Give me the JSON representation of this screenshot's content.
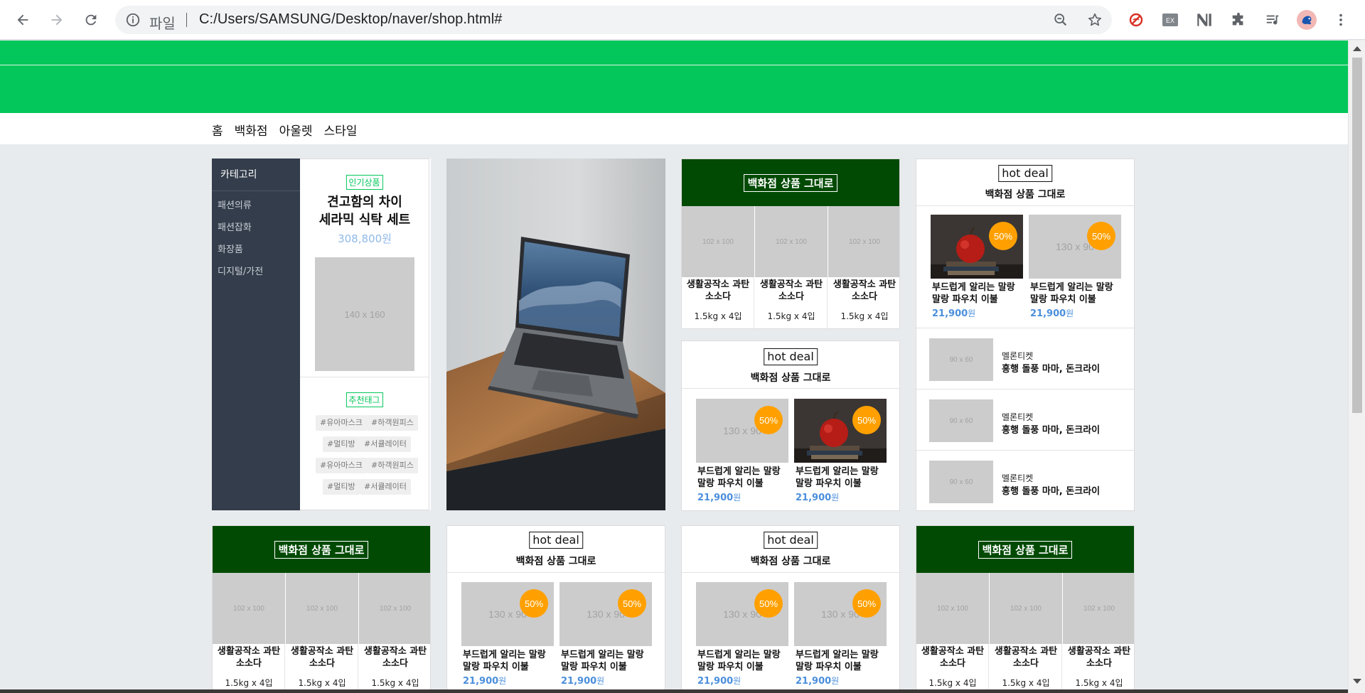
{
  "browser": {
    "chip_label": "파일",
    "url": "C:/Users/SAMSUNG/Desktop/naver/shop.html#"
  },
  "menu": [
    "홈",
    "백화점",
    "아울렛",
    "스타일"
  ],
  "category": {
    "title": "카테고리",
    "items": [
      "패션의류",
      "패션잡화",
      "화장품",
      "디지털/가전"
    ]
  },
  "popular": {
    "tag": "인기상품",
    "title_line1": "견고함의 차이",
    "title_line2": "세라믹 식탁 세트",
    "price": "308,800원",
    "image_label": "140 x 160",
    "rec_tag": "추천태그",
    "chips": [
      "#유아마스크",
      "#하객원피스",
      "#멀티방",
      "#서큘레이터",
      "#유아마스크",
      "#하객원피스",
      "#멀티방",
      "#서큘레이터"
    ]
  },
  "department": {
    "header": "백화점 상품 그대로",
    "item_image_label": "102 x 100",
    "item_name": "생활공작소 과탄 소소다",
    "item_weight": "1.5kg x 4입"
  },
  "hotdeal": {
    "label": "hot deal",
    "subtitle": "백화점 상품 그대로",
    "image_label": "130 x 90",
    "badge": "50%",
    "desc": "부드럽게 알리는 말랑 말랑 파우치 이불",
    "price": "21,900",
    "won": "원"
  },
  "tickets": {
    "image_label": "90 x 60",
    "category": "멜론티켓",
    "title": "흥행 돌풍 마마, 돈크라이"
  },
  "colors": {
    "naver_green": "#03c75a",
    "dept_green": "#014a04",
    "badge_orange": "#ffa000",
    "category_dark": "#333d4b",
    "price_blue": "#4b8fdc"
  }
}
